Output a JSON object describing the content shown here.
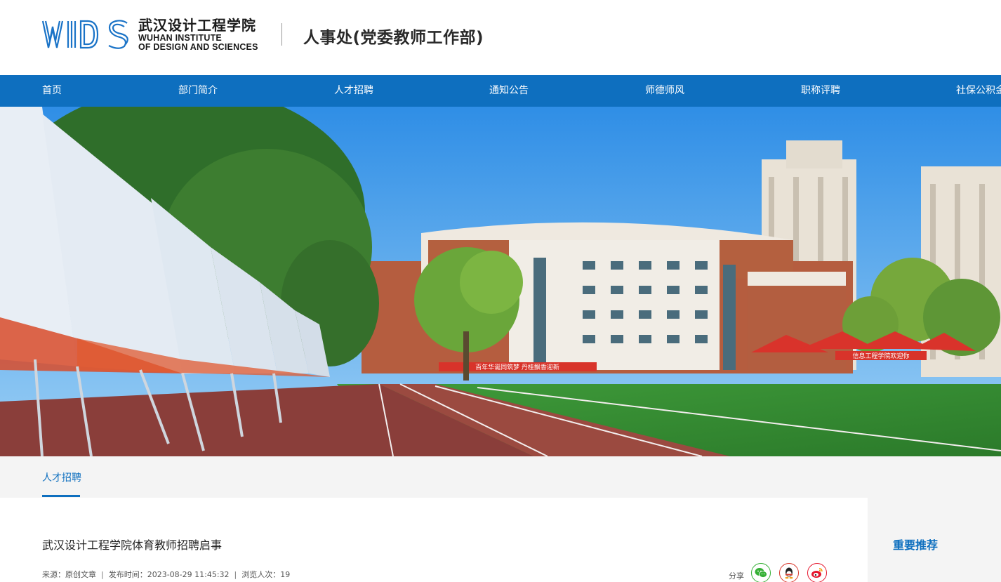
{
  "header": {
    "school_name_cn": "武汉设计工程学院",
    "school_name_en_1": "WUHAN INSTITUTE",
    "school_name_en_2": "OF DESIGN AND SCIENCES",
    "dept_title": "人事处(党委教师工作部)",
    "logo_icon": "wids-logo-icon"
  },
  "nav": {
    "items": [
      {
        "label": "首页"
      },
      {
        "label": "部门简介"
      },
      {
        "label": "人才招聘"
      },
      {
        "label": "通知公告"
      },
      {
        "label": "师德师风"
      },
      {
        "label": "职称评聘"
      },
      {
        "label": "社保公积金"
      }
    ]
  },
  "banner": {
    "banner_left_text": "百年华诞同筑梦  丹桂飘香迎新",
    "banner_right_text": "信息工程学院欢迎你"
  },
  "breadcrumb": {
    "current": "人才招聘"
  },
  "article": {
    "title": "武汉设计工程学院体育教师招聘启事",
    "meta_source": "来源：原创文章",
    "meta_date": "发布时间：2023-08-29 11:45:32",
    "meta_views": "浏览人次：19",
    "separator": "|",
    "share_label": "分享",
    "share_icons": [
      "wechat-icon",
      "qq-icon",
      "weibo-icon"
    ]
  },
  "sidebar": {
    "title": "重要推荐"
  },
  "colors": {
    "brand_blue": "#0e6fbf",
    "wechat_green": "#35b035",
    "qq_red": "#d9382c",
    "weibo_red": "#e6162d"
  }
}
